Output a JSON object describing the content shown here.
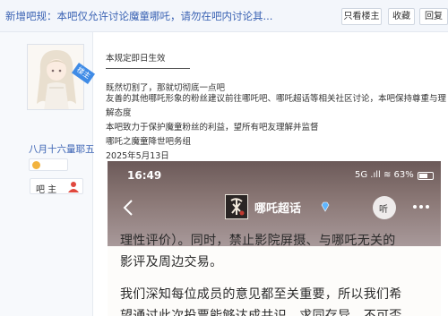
{
  "header": {
    "title": "新增吧规：本吧仅允许讨论魔童哪吒，请勿在吧内讨论其...",
    "buttons": {
      "owner_only": "只看楼主",
      "favorite": "收藏",
      "reply": "回复"
    }
  },
  "author": {
    "corner_badge": "楼主",
    "username": "八月十六量耶五",
    "role": "吧 主"
  },
  "post": {
    "lines": [
      "本规定即日生效",
      "既然切割了，那就切彻底一点吧",
      "友善的其他哪吒形象的粉丝建议前往哪吒吧、哪吒超话等相关社区讨论，本吧保持尊重与理",
      "解态度",
      "本吧致力于保护魔童粉丝的利益，望所有吧友理解并监督",
      "哪吒之魔童降世吧务组",
      "2025年5月13日"
    ]
  },
  "screenshot": {
    "status_time": "16:49",
    "status_right": "5G  .ıll  ≋  63%",
    "battery_level": 0.63,
    "title": "哪吒超话",
    "listen": "听",
    "text_lines": [
      "理性评价）。同时，禁止影院屏摄、与哪吒无关的",
      "影评及周边交易。",
      "我们深知每位成员的意见都至关重要，所以我们希",
      "望通过此次投票能够达成共识，求同存异，不可否"
    ]
  },
  "colors": {
    "link_blue": "#3a62b3",
    "badge_blue": "#3f8be6",
    "header_bg": "#f3f6fb"
  }
}
